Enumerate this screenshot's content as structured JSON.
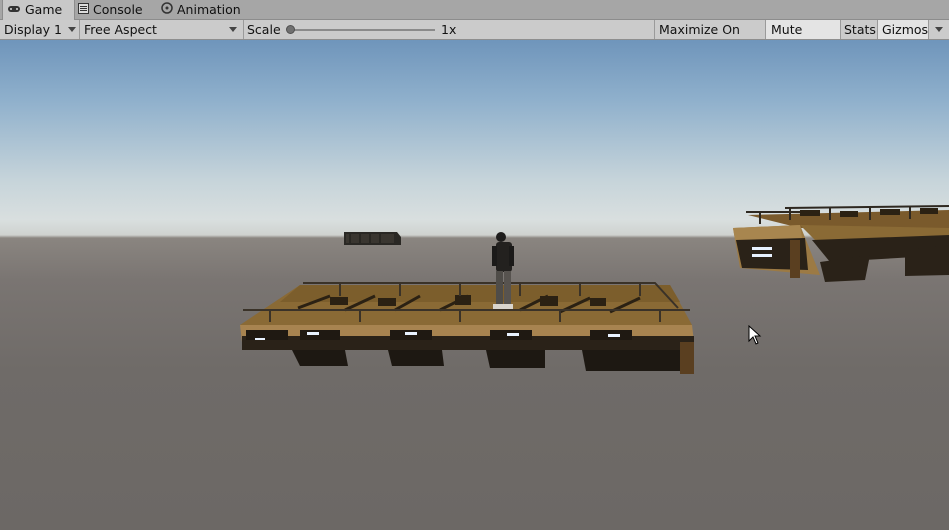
{
  "tabs": [
    {
      "label": "Game",
      "icon": "gamepad-icon",
      "active": true
    },
    {
      "label": "Console",
      "icon": "console-icon",
      "active": false
    },
    {
      "label": "Animation",
      "icon": "animation-icon",
      "active": false
    }
  ],
  "toolbar": {
    "display": "Display 1",
    "aspect": "Free Aspect",
    "scale_label": "Scale",
    "scale_value": "1x",
    "scale_slider_fraction": 0.0,
    "maximize_on_play": "Maximize On Play",
    "mute_audio": "Mute Audio",
    "stats": "Stats",
    "gizmos": "Gizmos"
  },
  "colors": {
    "tab_bar": "#a6a6a6",
    "toolbar": "#cbcbcb",
    "sky_top": "#6f95bb",
    "horizon": "#d9dfdf",
    "ground": "#6c6865",
    "platform_wood": "#8a6a35"
  }
}
